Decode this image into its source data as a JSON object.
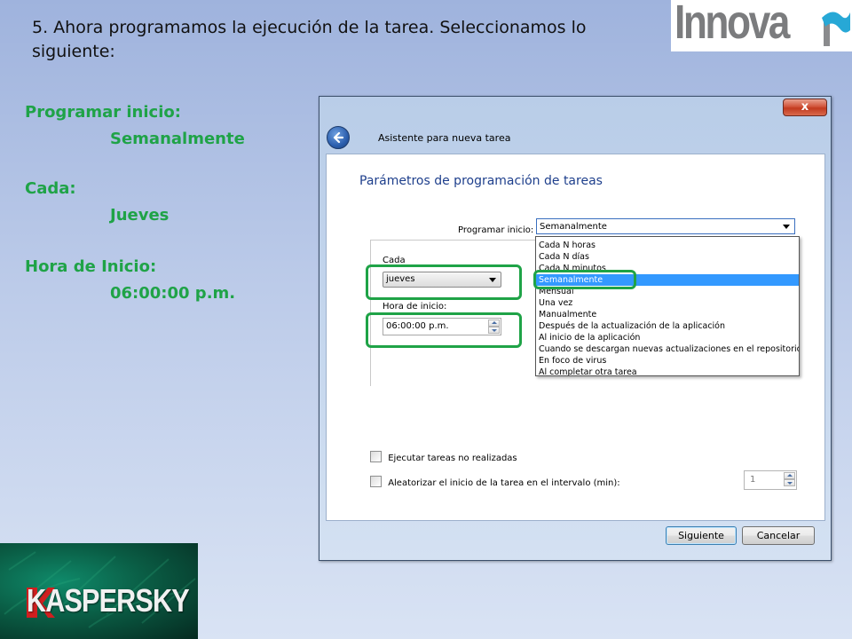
{
  "slide": {
    "title": "5. Ahora programamos la ejecución de la tarea. Seleccionamos lo siguiente:",
    "logo_text": "Innova",
    "brand_logo_text": "KASPERSKY"
  },
  "summary": {
    "items": [
      {
        "label": "Programar inicio:",
        "value": "Semanalmente"
      },
      {
        "label": "Cada:",
        "value": "Jueves"
      },
      {
        "label": "Hora de Inicio:",
        "value": "06:00:00 p.m."
      }
    ]
  },
  "dialog": {
    "title": "Asistente para nueva tarea",
    "close_label": "x",
    "heading": "Parámetros de programación de tareas",
    "schedule_label": "Programar inicio:",
    "schedule_value": "Semanalmente",
    "schedule_options": [
      "Cada N horas",
      "Cada N días",
      "Cada N minutos",
      "Semanalmente",
      "Mensual",
      "Una vez",
      "Manualmente",
      "Después de la actualización de la aplicación",
      "Al inicio de la aplicación",
      "Cuando se descargan nuevas actualizaciones en el repositorio",
      "En foco de virus",
      "Al completar otra tarea"
    ],
    "selected_option_index": 3,
    "every_label": "Cada",
    "every_value": "jueves",
    "start_time_label": "Hora de inicio:",
    "start_time_value": "06:00:00 p.m.",
    "run_missed_label": "Ejecutar tareas no realizadas",
    "run_missed_checked": false,
    "randomize_label": "Aleatorizar el inicio de la tarea en el intervalo (min):",
    "randomize_checked": false,
    "interval_value": "1",
    "next_button": "Siguiente",
    "cancel_button": "Cancelar"
  },
  "colors": {
    "accent_green": "#1fa347",
    "selection_blue": "#3399ff",
    "heading_blue": "#1e3f8c"
  }
}
